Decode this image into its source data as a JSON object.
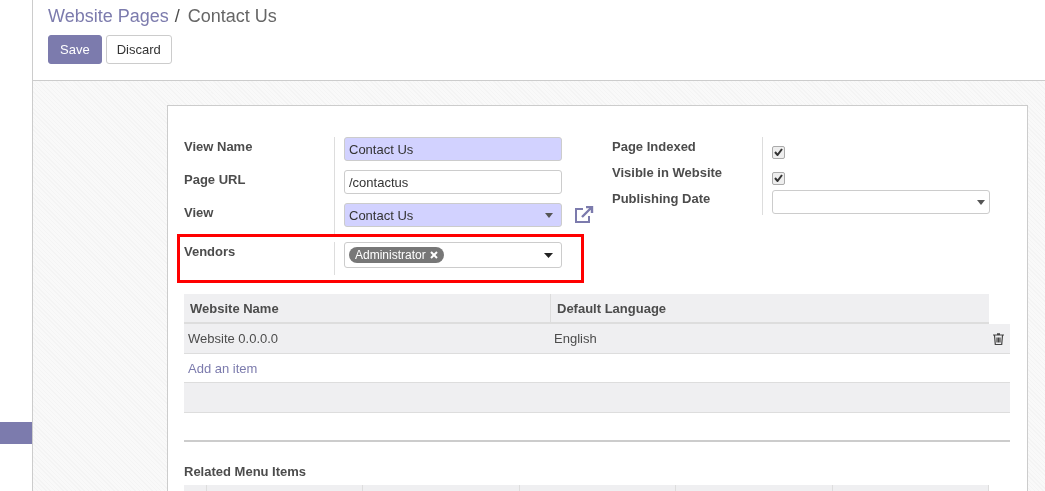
{
  "breadcrumb": {
    "parent": "Website Pages",
    "separator": "/",
    "current": "Contact Us"
  },
  "buttons": [
    {
      "label": "Save",
      "kind": "primary"
    },
    {
      "label": "Discard",
      "kind": "secondary"
    }
  ],
  "left_fields": [
    {
      "label": "View Name",
      "kind": "text",
      "value": "Contact Us",
      "required": true,
      "highlighted": false
    },
    {
      "label": "Page URL",
      "kind": "text",
      "value": "/contactus",
      "required": false,
      "highlighted": false
    },
    {
      "label": "View",
      "kind": "select",
      "value": "Contact Us",
      "required": true,
      "external_link": true,
      "highlighted": false
    },
    {
      "label": "Vendors",
      "kind": "tags",
      "tags": [
        "Administrator"
      ],
      "required": false,
      "highlighted": true
    }
  ],
  "right_fields": [
    {
      "label": "Page Indexed",
      "kind": "checkbox",
      "checked": true
    },
    {
      "label": "Visible in Website",
      "kind": "checkbox",
      "checked": true
    },
    {
      "label": "Publishing Date",
      "kind": "date"
    }
  ],
  "websites_table": {
    "columns": [
      "Website Name",
      "Default Language"
    ],
    "rows": [
      [
        "Website 0.0.0.0",
        "English"
      ]
    ],
    "add_item": "Add an item"
  },
  "related_menu": {
    "title": "Related Menu Items"
  }
}
